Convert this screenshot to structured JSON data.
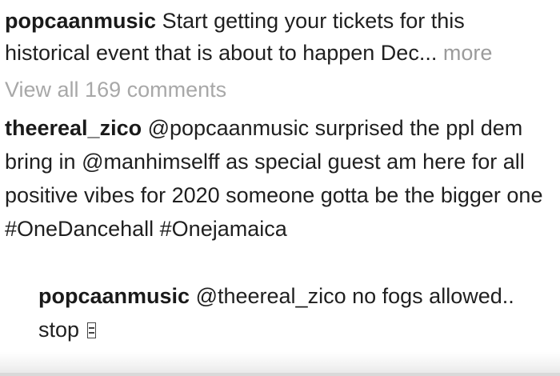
{
  "post": {
    "caption": {
      "username": "popcaanmusic",
      "text_line1": "Start getting your tickets for this",
      "text_line2": "historical event that is about to happen Dec",
      "ellipsis": "...",
      "more_label": "more"
    },
    "view_all_comments": "View all 169 comments",
    "comment": {
      "username": "theereal_zico",
      "mention1": "@popcaanmusic",
      "text1": "surprised the ppl dem bring in",
      "mention2": "@manhimselff",
      "text2": "as special guest am here for all positive vibes for 2020 someone gotta be the bigger one",
      "hashtag1": "#OneDancehall",
      "hashtag2": "#Onejamaica"
    },
    "reply": {
      "username": "popcaanmusic",
      "mention": "@theereal_zico",
      "text": "no fogs allowed.. stop"
    }
  }
}
